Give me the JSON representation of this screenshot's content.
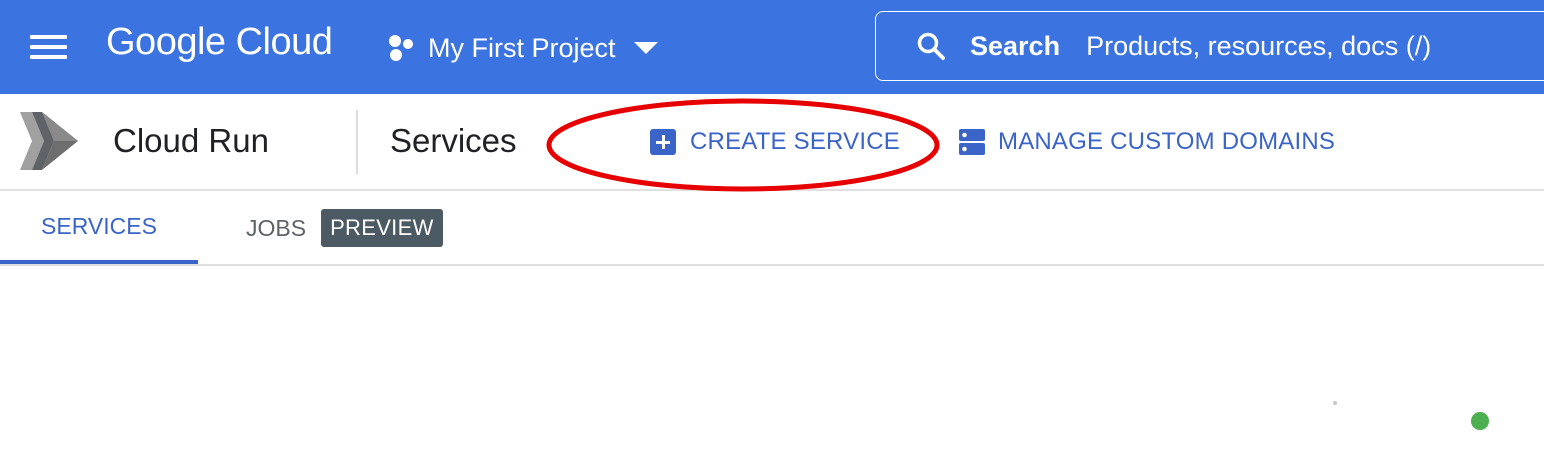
{
  "header": {
    "brand": "Google Cloud",
    "project": "My First Project",
    "search_label": "Search",
    "search_placeholder": "Products, resources, docs (/)"
  },
  "subheader": {
    "product": "Cloud Run",
    "page_title": "Services",
    "actions": [
      {
        "label": "CREATE SERVICE",
        "icon": "add-box-icon"
      },
      {
        "label": "MANAGE CUSTOM DOMAINS",
        "icon": "domains-icon"
      }
    ]
  },
  "tabs": [
    {
      "label": "SERVICES",
      "active": true
    },
    {
      "label": "JOBS",
      "badge": "PREVIEW",
      "active": false
    }
  ],
  "colors": {
    "header_bg": "#3b73e0",
    "accent": "#3b64c8",
    "annotation": "#e60000",
    "badge_bg": "#4b5a63",
    "status_green": "#4caf50"
  },
  "icons": [
    "menu-icon",
    "project-hexagon-icon",
    "chevron-down-icon",
    "search-icon",
    "cloud-run-logo",
    "add-box-icon",
    "domains-icon"
  ]
}
